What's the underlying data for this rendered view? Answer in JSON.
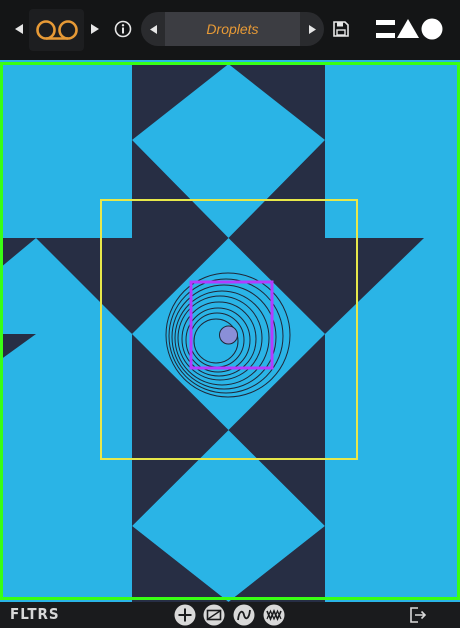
{
  "header": {
    "prev_bank_icon": "triangle-left",
    "bank_icon": "tape-reels",
    "next_bank_icon": "triangle-right",
    "info_icon": "info-circle",
    "preset_prev_icon": "triangle-left",
    "preset_name": "Droplets",
    "preset_next_icon": "triangle-right",
    "save_icon": "floppy-disk",
    "logo_icon": "shapes-logo"
  },
  "footer": {
    "brand": "FLTRS",
    "tool_icons": [
      "plus-circle",
      "gradient-box",
      "wave-n",
      "double-wave"
    ],
    "exit_icon": "exit-arrow"
  },
  "colors": {
    "accent_orange": "#e79a36",
    "pattern_cyan": "#2ab4e6",
    "pattern_navy": "#272e44",
    "canvas_frame_green": "#39ff14",
    "selection_yellow": "#e8e84a",
    "inner_selection_purple": "#b23cff",
    "center_dot": "#8a8fd8"
  }
}
